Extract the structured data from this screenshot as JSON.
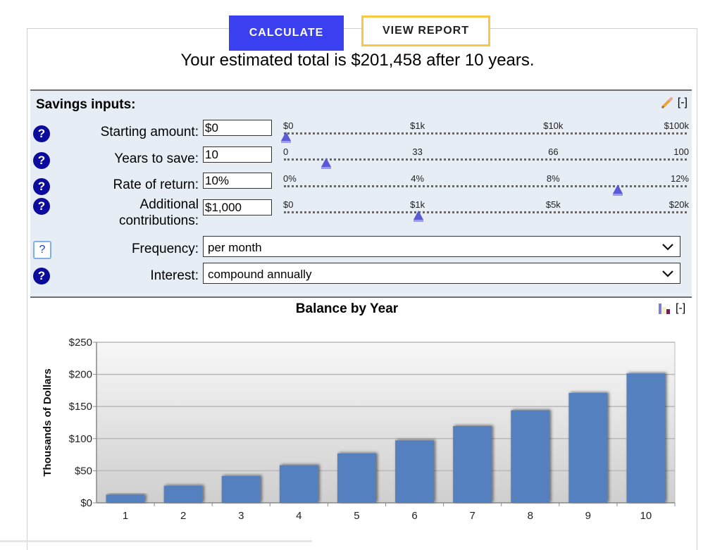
{
  "toolbar": {
    "calculate_label": "CALCULATE",
    "view_report_label": "VIEW REPORT"
  },
  "summary": "Your estimated total is $201,458 after 10 years.",
  "inputs": {
    "title": "Savings inputs:",
    "collapse_label": "[-]",
    "edit_icon": "pencil-icon",
    "rows": [
      {
        "label": "Starting amount:",
        "value": "$0",
        "help": "?",
        "slider": {
          "ticks": [
            "$0",
            "$1k",
            "$10k",
            "$100k"
          ],
          "position_fraction": 0.0
        }
      },
      {
        "label": "Years to save:",
        "value": "10",
        "help": "?",
        "slider": {
          "ticks": [
            "0",
            "33",
            "66",
            "100"
          ],
          "position_fraction": 0.1
        }
      },
      {
        "label": "Rate of return:",
        "value": "10%",
        "help": "?",
        "slider": {
          "ticks": [
            "0%",
            "4%",
            "8%",
            "12%"
          ],
          "position_fraction": 0.833
        }
      },
      {
        "label_line1": "Additional",
        "label_line2": "contributions:",
        "value": "$1,000",
        "help": "?",
        "slider": {
          "ticks": [
            "$0",
            "$1k",
            "$5k",
            "$20k"
          ],
          "position_fraction": 0.333
        }
      }
    ],
    "frequency": {
      "label": "Frequency:",
      "value": "per month",
      "help": "?"
    },
    "interest": {
      "label": "Interest:",
      "value": "compound annually",
      "help": "?"
    }
  },
  "chart_section": {
    "collapse_label": "[-]",
    "chart_icon": "bar-chart-icon"
  },
  "chart_data": {
    "type": "bar",
    "title": "Balance by Year",
    "xlabel": "",
    "ylabel": "Thousands of Dollars",
    "categories": [
      "1",
      "2",
      "3",
      "4",
      "5",
      "6",
      "7",
      "8",
      "9",
      "10"
    ],
    "values": [
      12.6,
      26.5,
      41.7,
      58.5,
      76.9,
      97.2,
      119.5,
      144.0,
      171.0,
      201.5
    ],
    "ylim": [
      0,
      250
    ],
    "yticks": [
      0,
      50,
      100,
      150,
      200,
      250
    ],
    "ytick_labels": [
      "$0",
      "$50",
      "$100",
      "$150",
      "$200",
      "$250"
    ],
    "grid": true,
    "legend": "none",
    "bar_color": "#5480c0"
  },
  "colors": {
    "calculate_bg": "#3a3ff0",
    "report_border": "#f7c843",
    "panel_bg": "#e6edf5",
    "help_bg": "#0b0b9c",
    "slider_thumb": "#5a5ad8"
  }
}
